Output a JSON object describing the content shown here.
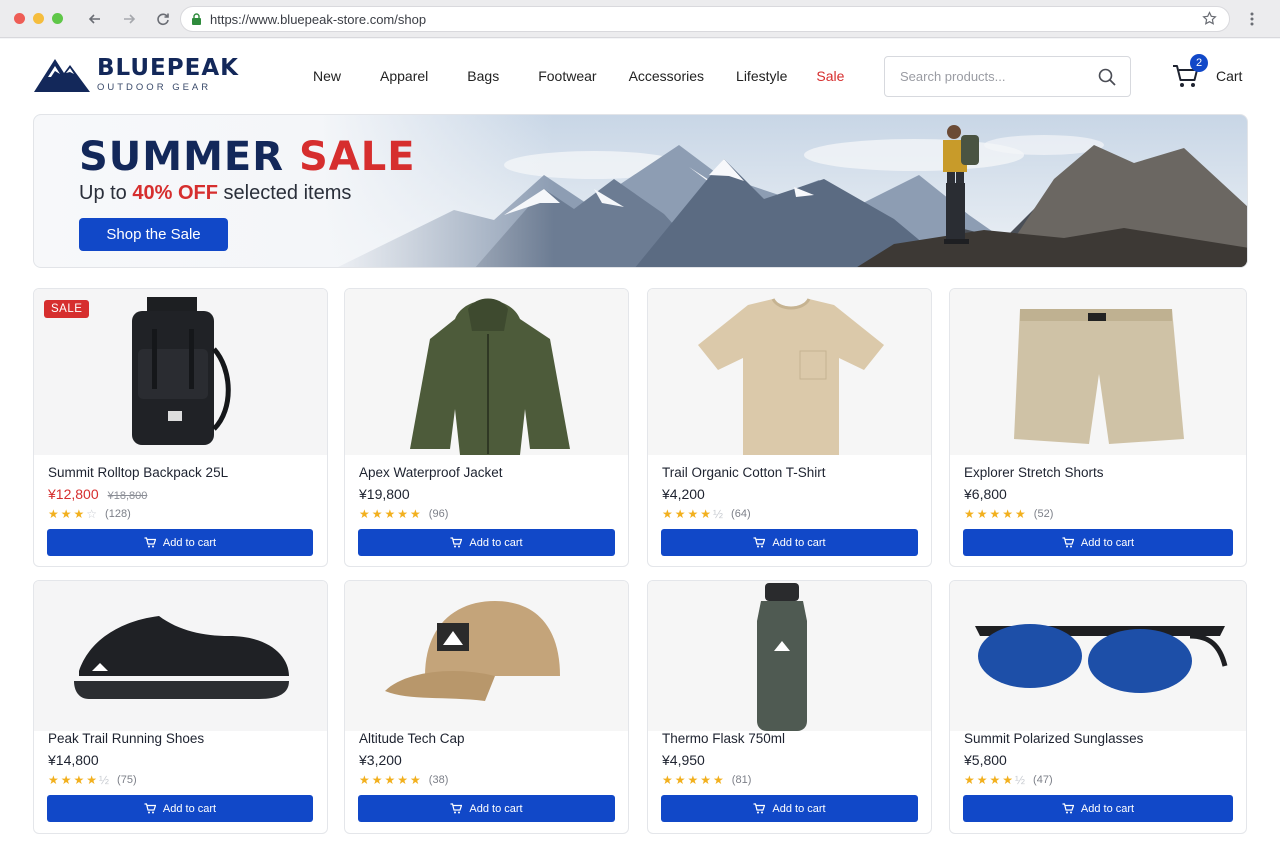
{
  "browser": {
    "url": "https://www.bluepeak-store.com/shop"
  },
  "header": {
    "brand": "BLUEPEAK",
    "tagline": "OUTDOOR GEAR",
    "nav": [
      "New",
      "Apparel",
      "Bags",
      "Footwear",
      "Accessories",
      "Lifestyle",
      "Sale"
    ],
    "search_placeholder": "Search products...",
    "cart_count": "2",
    "cart_label": "Cart"
  },
  "banner": {
    "title_part1": "SUMMER",
    "title_part2": "SALE",
    "sub_prefix": "Up to",
    "sub_pct": "40% OFF",
    "sub_suffix": "selected items",
    "button": "Shop the Sale"
  },
  "products": [
    {
      "name": "Summit Rolltop Backpack 25L",
      "price": "¥12,800",
      "old_price": "¥18,800",
      "rating": 3,
      "reviews": "(128)",
      "badge": "SALE",
      "cta": "Add to cart"
    },
    {
      "name": "Apex Waterproof Jacket",
      "price": "¥19,800",
      "old_price": "",
      "rating": 5,
      "reviews": "(96)",
      "badge": "",
      "cta": "Add to cart"
    },
    {
      "name": "Trail Organic Cotton T-Shirt",
      "price": "¥4,200",
      "old_price": "",
      "rating": 4.5,
      "reviews": "(64)",
      "badge": "",
      "cta": "Add to cart"
    },
    {
      "name": "Explorer Stretch Shorts",
      "price": "¥6,800",
      "old_price": "",
      "rating": 5,
      "reviews": "(52)",
      "badge": "",
      "cta": "Add to cart"
    },
    {
      "name": "Peak Trail Running Shoes",
      "price": "¥14,800",
      "old_price": "",
      "rating": 4.5,
      "reviews": "(75)",
      "badge": "",
      "cta": "Add to cart"
    },
    {
      "name": "Altitude Tech Cap",
      "price": "¥3,200",
      "old_price": "",
      "rating": 5,
      "reviews": "(38)",
      "badge": "",
      "cta": "Add to cart"
    },
    {
      "name": "Thermo Flask 750ml",
      "price": "¥4,950",
      "old_price": "",
      "rating": 5,
      "reviews": "(81)",
      "badge": "",
      "cta": "Add to cart"
    },
    {
      "name": "Summit Polarized Sunglasses",
      "price": "¥5,800",
      "old_price": "",
      "rating": 4.5,
      "reviews": "(47)",
      "badge": "",
      "cta": "Add to cart"
    }
  ],
  "colors": {
    "accent": "#1148c8",
    "sale": "#d62e2e",
    "brand": "#13285a",
    "star": "#f2b01e"
  }
}
